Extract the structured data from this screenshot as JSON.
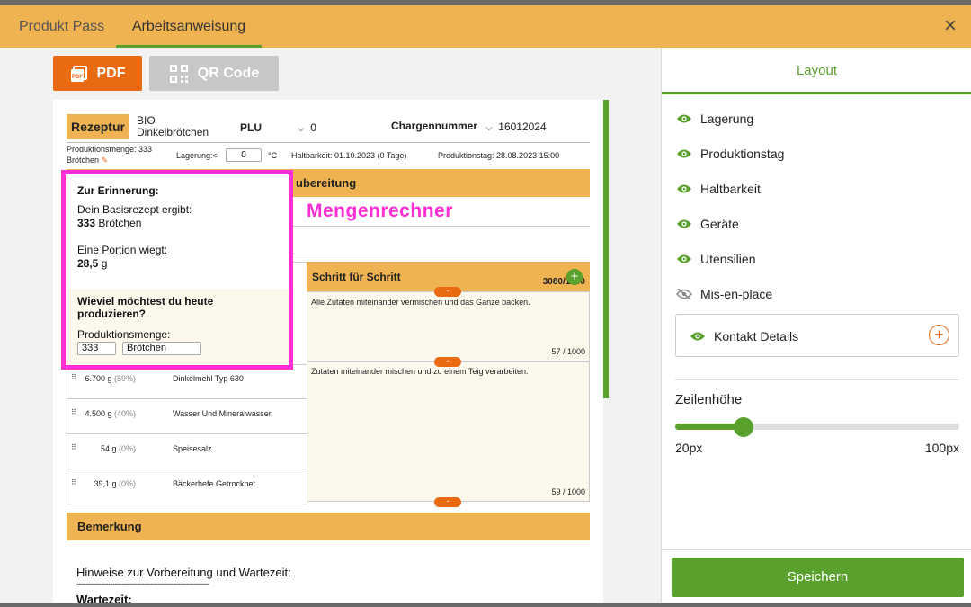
{
  "tabs": {
    "produkt_pass": "Produkt Pass",
    "arbeitsanweisung": "Arbeitsanweisung",
    "close": "×"
  },
  "toolbar": {
    "pdf": "PDF",
    "qr": "QR Code"
  },
  "doc": {
    "rezeptur_label": "Rezeptur",
    "recipe_name_1": "BIO",
    "recipe_name_2": "Dinkelbrötchen",
    "plu_label": "PLU",
    "plu_value": "0",
    "charge_label": "Chargennummer",
    "charge_value": "16012024",
    "prodmenge_label": "Produktionsmenge: 333",
    "prodmenge_unit": "Brötchen",
    "lagerung_label": "Lagerung:<",
    "lagerung_value": "0",
    "lagerung_unit": "°C",
    "haltbarkeit": "Haltbarkeit:  01.10.2023  (0 Tage)",
    "produktionstag": "Produktionstag:   28.08.2023 15:00",
    "zubereitung_suffix": "ubereitung",
    "mengenrechner": "Mengenrechner",
    "schritt_header": "Schritt für Schritt",
    "schritt_count": "3080/1000",
    "steps": [
      {
        "text": "Alle Zutaten miteinander vermischen und das Ganze backen.",
        "count": "57 / 1000"
      },
      {
        "text": "Zutaten miteinander mischen und zu einem Teig verarbeiten.",
        "count": "59 / 1000"
      }
    ],
    "ingredients": [
      {
        "amount": "6.700 g",
        "pct": "(59%)",
        "name": "Dinkelmehl Typ 630"
      },
      {
        "amount": "4.500 g",
        "pct": "(40%)",
        "name": "Wasser Und Mineralwasser"
      },
      {
        "amount": "54 g",
        "pct": "(0%)",
        "name": "Speisesalz"
      },
      {
        "amount": "39,1 g",
        "pct": "(0%)",
        "name": "Bäckerhefe Getrocknet"
      }
    ],
    "bemerkung": "Bemerkung",
    "hinweise": "Hinweise zur Vorbereitung und Wartezeit:",
    "dashes": "-----------------------------------------------------------",
    "wartezeit": "Wartezeit",
    "pill_minus": "-",
    "plus": "+"
  },
  "popup": {
    "title": "Zur Erinnerung:",
    "basis_label": "Dein Basisrezept ergibt:",
    "basis_value": "333",
    "basis_unit": "Brötchen",
    "portion_label": "Eine Portion wiegt:",
    "portion_value": "28,5",
    "portion_unit": "g",
    "question": "Wieviel möchtest du heute produzieren?",
    "prod_label": "Produktionsmenge:",
    "prod_value": "333",
    "prod_unit": "Brötchen"
  },
  "layout": {
    "title": "Layout",
    "items": [
      {
        "label": "Lagerung",
        "visible": true
      },
      {
        "label": "Produktionstag",
        "visible": true
      },
      {
        "label": "Haltbarkeit",
        "visible": true
      },
      {
        "label": "Geräte",
        "visible": true
      },
      {
        "label": "Utensilien",
        "visible": true
      },
      {
        "label": "Mis-en-place",
        "visible": false
      }
    ],
    "kontakt": "Kontakt Details",
    "zeilenhoehe": "Zeilenhöhe",
    "slider_min": "20px",
    "slider_max": "100px",
    "slider_fraction": 0.24,
    "save": "Speichern"
  },
  "colors": {
    "accent_green": "#5aa02c",
    "orange": "#ea6a12",
    "header_yellow": "#efb451",
    "highlight_magenta": "#ff2dd4"
  },
  "icons": {
    "eye": "eye-icon",
    "eye_off": "eye-off-icon",
    "plus": "plus-circle-icon",
    "pencil": "pencil-icon",
    "close": "close-icon",
    "pdf": "pdf-icon",
    "qr": "qr-icon",
    "drag": "drag-handle-icon"
  }
}
